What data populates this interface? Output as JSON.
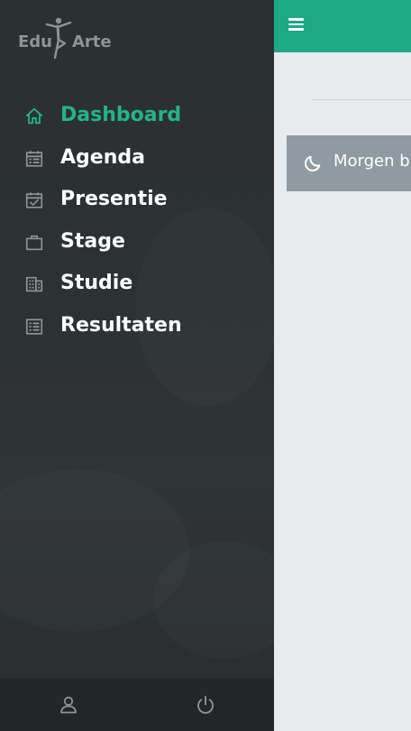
{
  "app": {
    "logo_left": "Edu",
    "logo_right": "Arte"
  },
  "colors": {
    "accent": "#1fa884",
    "active_text": "#23b38d",
    "sidebar_bg": "#2c3133",
    "notice_bg": "#8f9ba2"
  },
  "sidebar": {
    "items": [
      {
        "label": "Dashboard",
        "icon": "home-icon",
        "active": true
      },
      {
        "label": "Agenda",
        "icon": "calendar-icon",
        "active": false
      },
      {
        "label": "Presentie",
        "icon": "calendar-check-icon",
        "active": false
      },
      {
        "label": "Stage",
        "icon": "briefcase-icon",
        "active": false
      },
      {
        "label": "Studie",
        "icon": "building-icon",
        "active": false
      },
      {
        "label": "Resultaten",
        "icon": "list-icon",
        "active": false
      }
    ],
    "footer": {
      "left_icon": "user-icon",
      "right_icon": "power-icon"
    }
  },
  "main": {
    "topbar_icon": "menu-icon",
    "notice": {
      "icon": "moon-icon",
      "text": "Morgen b"
    }
  }
}
